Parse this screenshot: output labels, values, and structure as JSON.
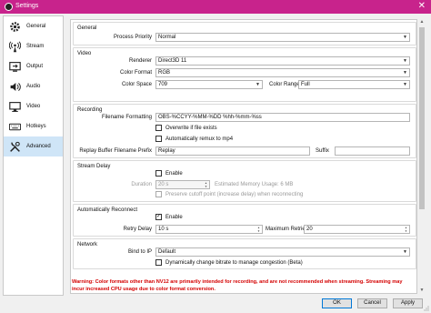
{
  "window": {
    "title": "Settings",
    "close_glyph": "✕"
  },
  "sidebar": {
    "items": [
      {
        "label": "General",
        "icon": "gear-icon"
      },
      {
        "label": "Stream",
        "icon": "broadcast-icon"
      },
      {
        "label": "Output",
        "icon": "output-icon"
      },
      {
        "label": "Audio",
        "icon": "speaker-icon"
      },
      {
        "label": "Video",
        "icon": "monitor-icon"
      },
      {
        "label": "Hotkeys",
        "icon": "keyboard-icon"
      },
      {
        "label": "Advanced",
        "icon": "tools-icon"
      }
    ],
    "active_index": 6
  },
  "general": {
    "title": "General",
    "process_priority_label": "Process Priority",
    "process_priority": "Normal"
  },
  "video": {
    "title": "Video",
    "renderer_label": "Renderer",
    "renderer": "Direct3D 11",
    "color_format_label": "Color Format",
    "color_format": "RGB",
    "color_space_label": "Color Space",
    "color_space": "709",
    "color_range_label": "Color Range",
    "color_range": "Full"
  },
  "recording": {
    "title": "Recording",
    "filename_label": "Filename Formatting",
    "filename": "OBS-%CCYY-%MM-%DD %hh-%mm-%ss",
    "overwrite_label": "Overwrite if file exists",
    "remux_label": "Automatically remux to mp4",
    "replay_prefix_label": "Replay Buffer Filename Prefix",
    "replay_prefix": "Replay",
    "suffix_label": "Suffix",
    "suffix": ""
  },
  "stream_delay": {
    "title": "Stream Delay",
    "enable_label": "Enable",
    "duration_label": "Duration",
    "duration": "20 s",
    "memory_usage": "Estimated Memory Usage: 6 MB",
    "preserve_label": "Preserve cutoff point (increase delay) when reconnecting"
  },
  "auto_reconnect": {
    "title": "Automatically Reconnect",
    "enable_label": "Enable",
    "check_glyph": "✓",
    "retry_delay_label": "Retry Delay",
    "retry_delay": "10 s",
    "max_retries_label": "Maximum Retries",
    "max_retries": "20"
  },
  "network": {
    "title": "Network",
    "bind_ip_label": "Bind to IP",
    "bind_ip": "Default",
    "dynamic_bitrate_label": "Dynamically change bitrate to manage congestion (Beta)"
  },
  "warning": "Warning: Color formats other than NV12 are primarily intended for recording, and are not recommended when streaming. Streaming may incur increased CPU usage due to color format conversion.",
  "buttons": {
    "ok": "OK",
    "cancel": "Cancel",
    "apply": "Apply"
  },
  "colors": {
    "titlebar": "#c8238c",
    "active_item": "#cfe5f7",
    "warning": "#d40000"
  }
}
